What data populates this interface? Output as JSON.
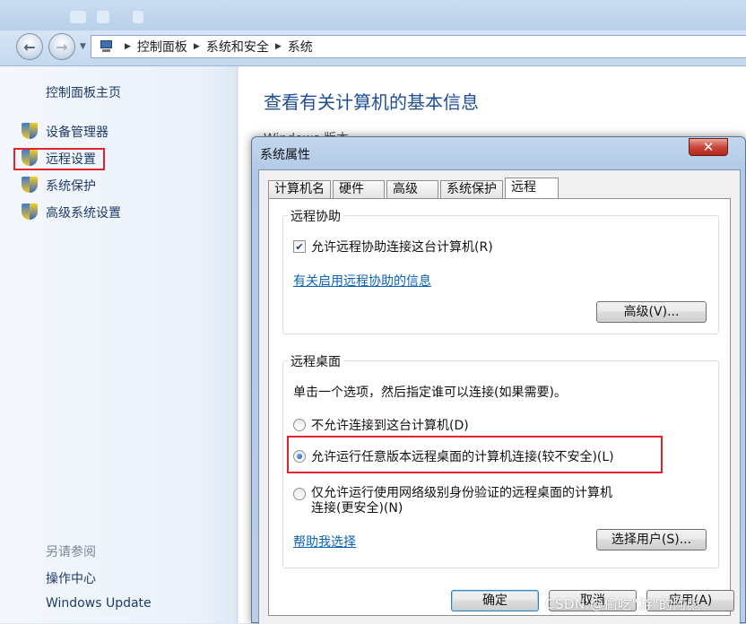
{
  "breadcrumb": {
    "items": [
      "控制面板",
      "系统和安全",
      "系统"
    ]
  },
  "leftnav": {
    "home": "控制面板主页",
    "items": [
      {
        "label": "设备管理器"
      },
      {
        "label": "远程设置"
      },
      {
        "label": "系统保护"
      },
      {
        "label": "高级系统设置"
      }
    ],
    "see_also": "另请参阅",
    "links": [
      "操作中心",
      "Windows Update"
    ]
  },
  "content": {
    "title": "查看有关计算机的基本信息",
    "behind_text": "Windows 版本"
  },
  "dialog": {
    "title": "系统属性",
    "close": "✕",
    "tabs": [
      "计算机名",
      "硬件",
      "高级",
      "系统保护",
      "远程"
    ],
    "assist": {
      "group_title": "远程协助",
      "checkbox_label": "允许远程协助连接这台计算机(R)",
      "checkbox_checked": true,
      "info_link": "有关启用远程协助的信息",
      "advanced_button": "高级(V)..."
    },
    "desktop": {
      "group_title": "远程桌面",
      "instruction": "单击一个选项，然后指定谁可以连接(如果需要)。",
      "options": [
        {
          "label": "不允许连接到这台计算机(D)",
          "selected": false
        },
        {
          "label": "允许运行任意版本远程桌面的计算机连接(较不安全)(L)",
          "selected": true
        },
        {
          "label_line1": "仅允许运行使用网络级别身份验证的远程桌面的计算机",
          "label_line2": "连接(更安全)(N)",
          "selected": false
        }
      ],
      "help_link": "帮助我选择",
      "select_users_button": "选择用户(S)..."
    },
    "buttons": {
      "ok": "确定",
      "cancel": "取消",
      "apply": "应用(A)"
    }
  },
  "watermark": "CSDN @偷吃\"游\"的阿彪",
  "colors": {
    "highlight_box": "#e5212d",
    "link": "#0b63b8",
    "title": "#1e4e97"
  }
}
